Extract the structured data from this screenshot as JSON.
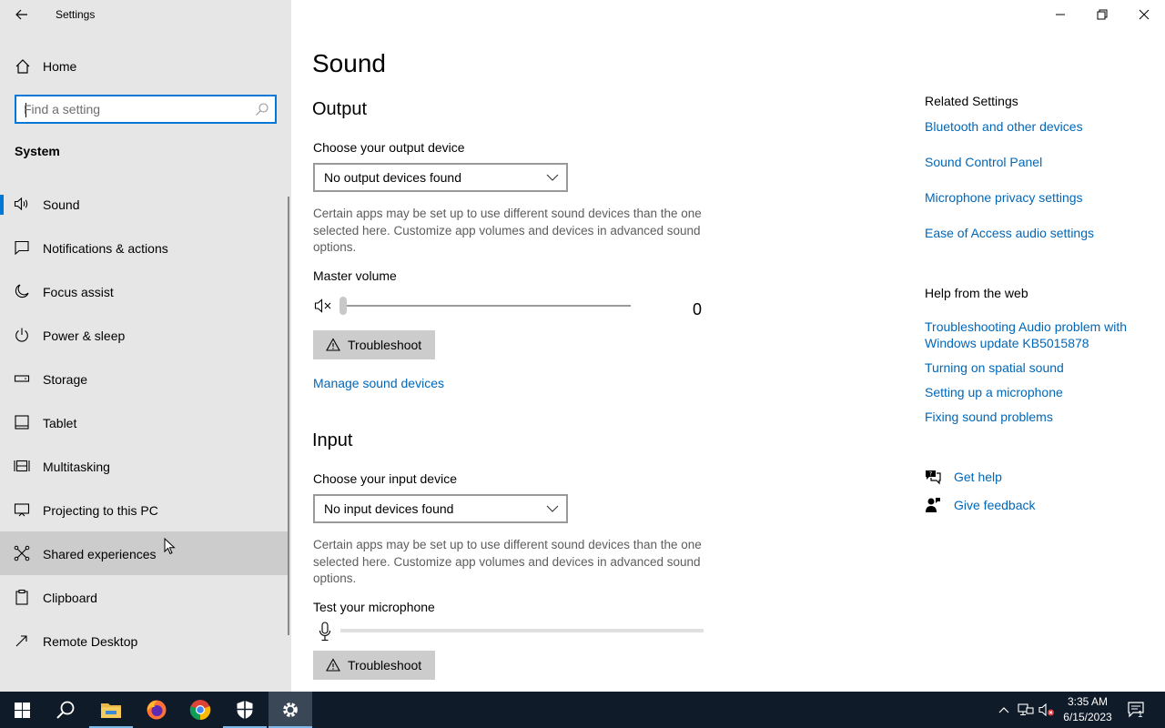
{
  "window": {
    "title": "Settings"
  },
  "sidebar": {
    "home_label": "Home",
    "search_placeholder": "Find a setting",
    "section_title": "System",
    "items": [
      {
        "label": "Sound",
        "icon": "speaker-icon"
      },
      {
        "label": "Notifications & actions",
        "icon": "notification-icon"
      },
      {
        "label": "Focus assist",
        "icon": "moon-icon"
      },
      {
        "label": "Power & sleep",
        "icon": "power-icon"
      },
      {
        "label": "Storage",
        "icon": "storage-icon"
      },
      {
        "label": "Tablet",
        "icon": "tablet-icon"
      },
      {
        "label": "Multitasking",
        "icon": "multitasking-icon"
      },
      {
        "label": "Projecting to this PC",
        "icon": "projecting-icon"
      },
      {
        "label": "Shared experiences",
        "icon": "shared-icon"
      },
      {
        "label": "Clipboard",
        "icon": "clipboard-icon"
      },
      {
        "label": "Remote Desktop",
        "icon": "remote-desktop-icon"
      }
    ]
  },
  "main": {
    "page_title": "Sound",
    "output": {
      "heading": "Output",
      "device_label": "Choose your output device",
      "device_value": "No output devices found",
      "description": "Certain apps may be set up to use different sound devices than the one selected here. Customize app volumes and devices in advanced sound options.",
      "volume_label": "Master volume",
      "volume_value": "0",
      "volume_level": 0,
      "troubleshoot_label": "Troubleshoot",
      "manage_link": "Manage sound devices"
    },
    "input": {
      "heading": "Input",
      "device_label": "Choose your input device",
      "device_value": "No input devices found",
      "description": "Certain apps may be set up to use different sound devices than the one selected here. Customize app volumes and devices in advanced sound options.",
      "test_label": "Test your microphone",
      "troubleshoot_label": "Troubleshoot"
    }
  },
  "related": {
    "heading": "Related Settings",
    "links": [
      "Bluetooth and other devices",
      "Sound Control Panel",
      "Microphone privacy settings",
      "Ease of Access audio settings"
    ],
    "help_heading": "Help from the web",
    "help_links": [
      "Troubleshooting Audio problem with Windows update KB5015878",
      "Turning on spatial sound",
      "Setting up a microphone",
      "Fixing sound problems"
    ],
    "get_help": "Get help",
    "give_feedback": "Give feedback"
  },
  "taskbar": {
    "time": "3:35 AM",
    "date": "6/15/2023",
    "notification_count": "1"
  },
  "colors": {
    "accent": "#0078d7",
    "link": "#0067b8",
    "sidebar_bg": "#e6e6e6",
    "taskbar_bg": "#0f1b28"
  }
}
